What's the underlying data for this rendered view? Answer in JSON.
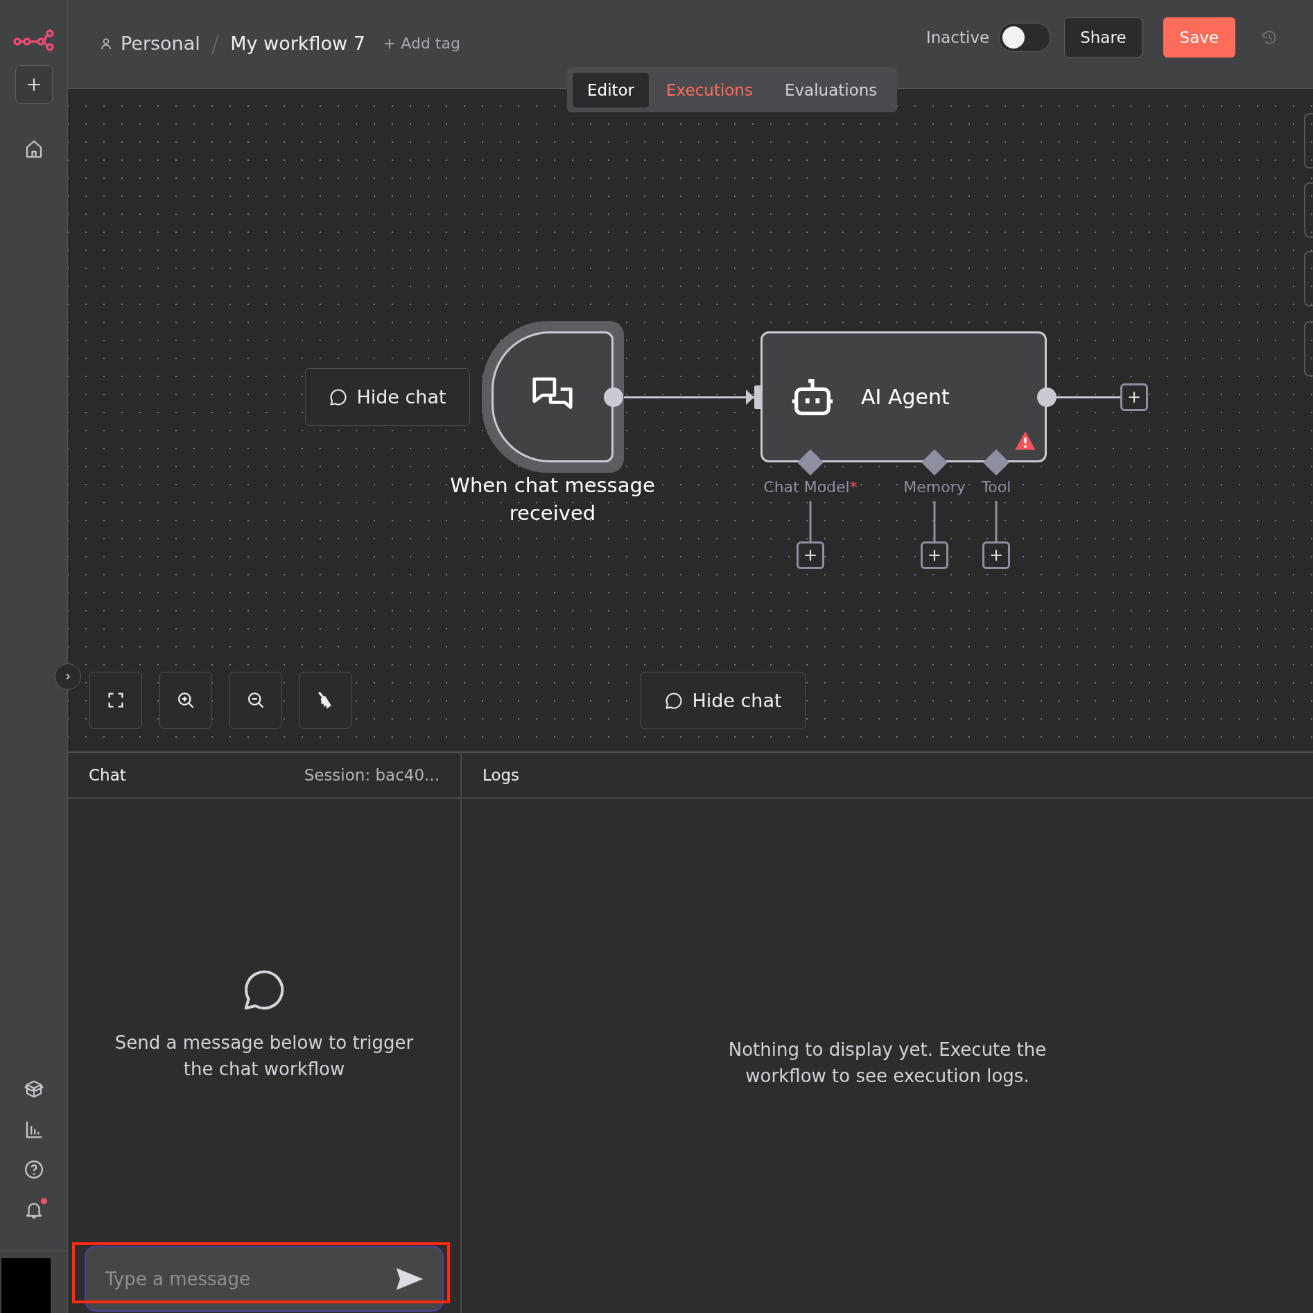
{
  "sidebar": {
    "notification_unread": true
  },
  "topbar": {
    "project": "Personal",
    "separator": "/",
    "workflow": "My workflow 7",
    "add_tag": "+ Add tag",
    "status": {
      "label": "Inactive",
      "on": false
    },
    "share": "Share",
    "save": "Save"
  },
  "tabs": [
    {
      "label": "Editor",
      "selected": true,
      "accent": false
    },
    {
      "label": "Executions",
      "selected": false,
      "accent": true
    },
    {
      "label": "Evaluations",
      "selected": false,
      "accent": false
    }
  ],
  "canvas": {
    "hide_chat_node": "Hide chat",
    "hide_chat_toolbar": "Hide chat",
    "nodes": [
      {
        "kind": "trigger",
        "label": "When chat message received"
      },
      {
        "kind": "agent",
        "label": "AI Agent",
        "warning": true,
        "inputs": [
          {
            "label": "Chat Model",
            "marker": "*"
          },
          {
            "label": "Memory"
          },
          {
            "label": "Tool"
          }
        ]
      }
    ]
  },
  "chat": {
    "title": "Chat",
    "session": "Session: bac40...",
    "empty_message": "Send a message below to trigger the chat workflow",
    "input": {
      "placeholder": "Type a message"
    },
    "highlighted": true
  },
  "logs": {
    "title": "Logs",
    "empty_message": "Nothing to display yet. Execute the workflow to see execution logs."
  }
}
